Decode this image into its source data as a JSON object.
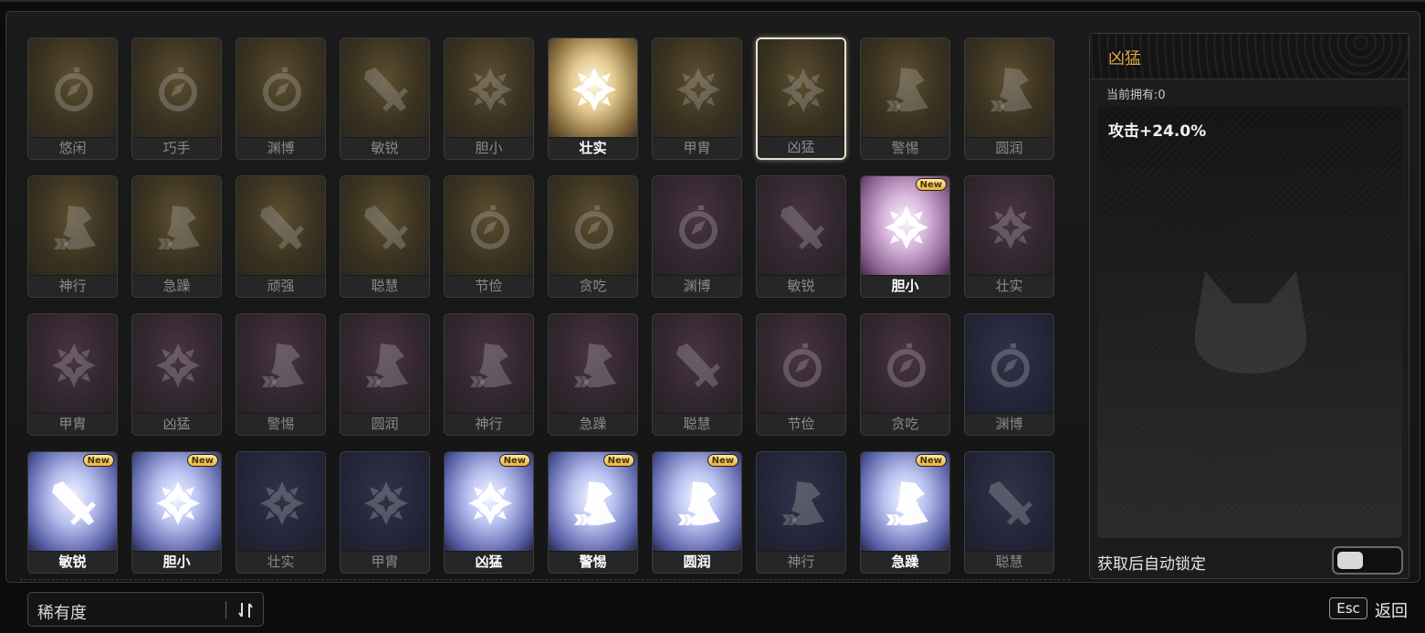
{
  "detail": {
    "title": "凶猛",
    "owned": "当前拥有:0",
    "effect": "攻击+24.0%",
    "auto_lock_label": "获取后自动锁定",
    "auto_lock_on": false
  },
  "sort": {
    "label": "稀有度"
  },
  "footer": {
    "esc_key": "Esc",
    "back_label": "返回"
  },
  "new_badge": "New",
  "cards": [
    {
      "label": "悠闲",
      "icon": "compass-icon",
      "rarity": "gold",
      "bright": false,
      "new": false
    },
    {
      "label": "巧手",
      "icon": "compass-icon",
      "rarity": "gold",
      "bright": false,
      "new": false
    },
    {
      "label": "渊博",
      "icon": "compass-icon",
      "rarity": "gold",
      "bright": false,
      "new": false
    },
    {
      "label": "敏锐",
      "icon": "sword-icon",
      "rarity": "gold",
      "bright": false,
      "new": false
    },
    {
      "label": "胆小",
      "icon": "star-emblem-icon",
      "rarity": "gold",
      "bright": false,
      "new": false
    },
    {
      "label": "壮实",
      "icon": "star-emblem-icon",
      "rarity": "gold",
      "bright": true,
      "new": false
    },
    {
      "label": "甲胄",
      "icon": "star-emblem-icon",
      "rarity": "gold",
      "bright": false,
      "new": false
    },
    {
      "label": "凶猛",
      "icon": "star-emblem-icon",
      "rarity": "gold",
      "bright": false,
      "new": false,
      "selected": true
    },
    {
      "label": "警惕",
      "icon": "boot-icon",
      "rarity": "gold",
      "bright": false,
      "new": false
    },
    {
      "label": "圆润",
      "icon": "boot-icon",
      "rarity": "gold",
      "bright": false,
      "new": false
    },
    {
      "label": "神行",
      "icon": "boot-icon",
      "rarity": "gold",
      "bright": false,
      "new": false
    },
    {
      "label": "急躁",
      "icon": "boot-icon",
      "rarity": "gold",
      "bright": false,
      "new": false
    },
    {
      "label": "顽强",
      "icon": "sword-icon",
      "rarity": "gold",
      "bright": false,
      "new": false
    },
    {
      "label": "聪慧",
      "icon": "sword-icon",
      "rarity": "gold",
      "bright": false,
      "new": false
    },
    {
      "label": "节俭",
      "icon": "compass-icon",
      "rarity": "gold",
      "bright": false,
      "new": false
    },
    {
      "label": "贪吃",
      "icon": "compass-icon",
      "rarity": "gold",
      "bright": false,
      "new": false
    },
    {
      "label": "渊博",
      "icon": "compass-icon",
      "rarity": "purple",
      "bright": false,
      "new": false
    },
    {
      "label": "敏锐",
      "icon": "sword-icon",
      "rarity": "purple",
      "bright": false,
      "new": false
    },
    {
      "label": "胆小",
      "icon": "star-emblem-icon",
      "rarity": "purple",
      "bright": true,
      "new": true
    },
    {
      "label": "壮实",
      "icon": "star-emblem-icon",
      "rarity": "purple",
      "bright": false,
      "new": false
    },
    {
      "label": "甲胄",
      "icon": "star-emblem-icon",
      "rarity": "purple",
      "bright": false,
      "new": false
    },
    {
      "label": "凶猛",
      "icon": "star-emblem-icon",
      "rarity": "purple",
      "bright": false,
      "new": false
    },
    {
      "label": "警惕",
      "icon": "boot-icon",
      "rarity": "purple",
      "bright": false,
      "new": false
    },
    {
      "label": "圆润",
      "icon": "boot-icon",
      "rarity": "purple",
      "bright": false,
      "new": false
    },
    {
      "label": "神行",
      "icon": "boot-icon",
      "rarity": "purple",
      "bright": false,
      "new": false
    },
    {
      "label": "急躁",
      "icon": "boot-icon",
      "rarity": "purple",
      "bright": false,
      "new": false
    },
    {
      "label": "聪慧",
      "icon": "sword-icon",
      "rarity": "purple",
      "bright": false,
      "new": false
    },
    {
      "label": "节俭",
      "icon": "compass-icon",
      "rarity": "purple",
      "bright": false,
      "new": false
    },
    {
      "label": "贪吃",
      "icon": "compass-icon",
      "rarity": "purple",
      "bright": false,
      "new": false
    },
    {
      "label": "渊博",
      "icon": "compass-icon",
      "rarity": "blue",
      "bright": false,
      "new": false
    },
    {
      "label": "敏锐",
      "icon": "sword-icon",
      "rarity": "blue",
      "bright": true,
      "new": true
    },
    {
      "label": "胆小",
      "icon": "star-emblem-icon",
      "rarity": "blue",
      "bright": true,
      "new": true
    },
    {
      "label": "壮实",
      "icon": "star-emblem-icon",
      "rarity": "blue",
      "bright": false,
      "new": false
    },
    {
      "label": "甲胄",
      "icon": "star-emblem-icon",
      "rarity": "blue",
      "bright": false,
      "new": false
    },
    {
      "label": "凶猛",
      "icon": "star-emblem-icon",
      "rarity": "blue",
      "bright": true,
      "new": true
    },
    {
      "label": "警惕",
      "icon": "boot-icon",
      "rarity": "blue",
      "bright": true,
      "new": true
    },
    {
      "label": "圆润",
      "icon": "boot-icon",
      "rarity": "blue",
      "bright": true,
      "new": true
    },
    {
      "label": "神行",
      "icon": "boot-icon",
      "rarity": "blue",
      "bright": false,
      "new": false
    },
    {
      "label": "急躁",
      "icon": "boot-icon",
      "rarity": "blue",
      "bright": true,
      "new": true
    },
    {
      "label": "聪慧",
      "icon": "sword-icon",
      "rarity": "blue",
      "bright": false,
      "new": false
    }
  ]
}
